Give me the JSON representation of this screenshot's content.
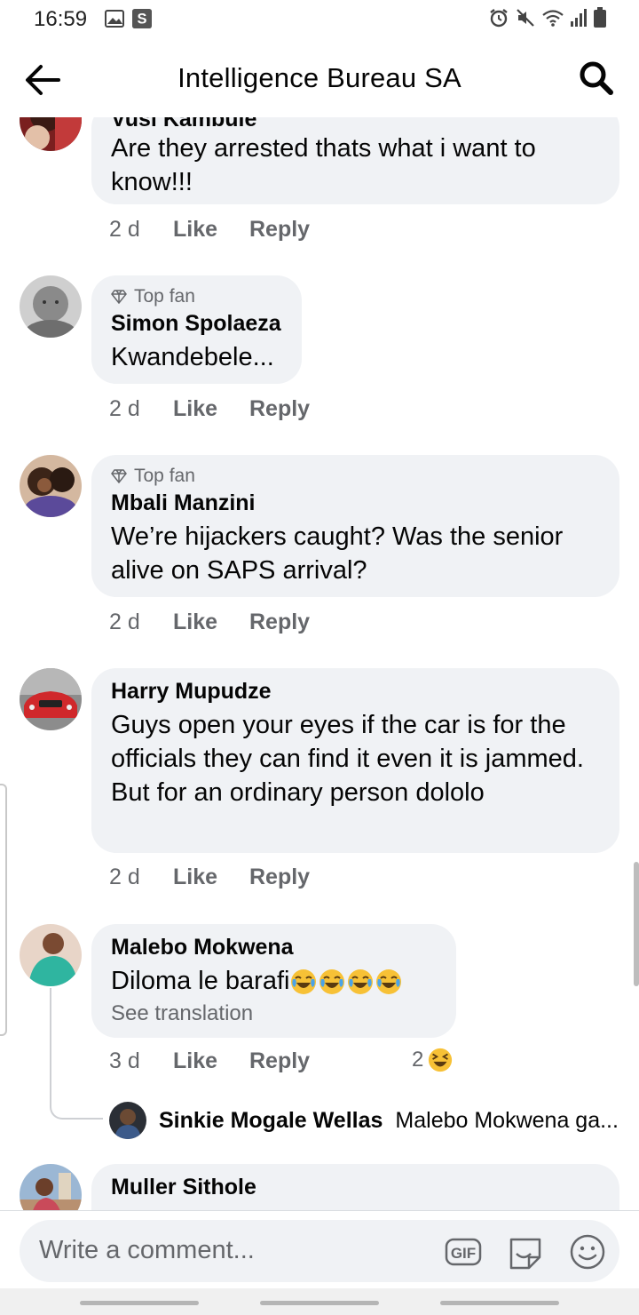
{
  "status": {
    "time": "16:59"
  },
  "header": {
    "title": "Intelligence Bureau SA"
  },
  "comments": [
    {
      "name": "Vusi Kambule",
      "text": "Are they arrested thats what i want to know!!!",
      "time": "2 d",
      "like": "Like",
      "reply": "Reply"
    },
    {
      "badge": "Top fan",
      "name": "Simon Spolaeza",
      "text": "Kwandebele...",
      "time": "2 d",
      "like": "Like",
      "reply": "Reply"
    },
    {
      "badge": "Top fan",
      "name": "Mbali Manzini",
      "text": "We’re hijackers caught? Was the senior alive on SAPS arrival?",
      "time": "2 d",
      "like": "Like",
      "reply": "Reply"
    },
    {
      "name": "Harry Mupudze",
      "text": "Guys open your eyes if the car is for the officials they can find it even it is jammed. But for an ordinary person dololo",
      "time": "2 d",
      "like": "Like",
      "reply": "Reply"
    },
    {
      "name": "Malebo Mokwena",
      "text": "Diloma le barafi",
      "translate": "See translation",
      "time": "3 d",
      "like": "Like",
      "reply": "Reply",
      "reaction_count": "2",
      "reaction_icon": "laughing-emoji"
    },
    {
      "name": "Muller Sithole"
    }
  ],
  "reply_preview": {
    "name": "Sinkie Mogale Wellas",
    "text": "Malebo Mokwena ga..."
  },
  "composer": {
    "placeholder": "Write a comment...",
    "gif": "GIF"
  }
}
